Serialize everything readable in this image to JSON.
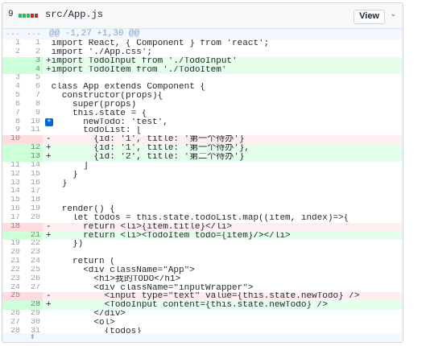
{
  "file": {
    "change_count": "9",
    "diffstat_colors": [
      "#2cbe4e",
      "#2cbe4e",
      "#2cbe4e",
      "#cb2431",
      "#cb2431"
    ],
    "name": "src/App.js",
    "view_label": "View",
    "caret": "⌄"
  },
  "hunk": {
    "ellipsis_old": "...",
    "ellipsis_new": "...",
    "header": "@@ -1,27 +1,30 @@"
  },
  "lines": [
    {
      "type": "ctx",
      "old": "1",
      "new": "1",
      "code": " import React, { Component } from 'react';"
    },
    {
      "type": "ctx",
      "old": "2",
      "new": "2",
      "code": " import './App.css';"
    },
    {
      "type": "add",
      "old": "",
      "new": "3",
      "code": "+import TodoInput from './TodoInput'"
    },
    {
      "type": "add",
      "old": "",
      "new": "4",
      "code": "+import TodoItem from './TodoItem'"
    },
    {
      "type": "ctx",
      "old": "3",
      "new": "5",
      "code": ""
    },
    {
      "type": "ctx",
      "old": "4",
      "new": "6",
      "code": " class App extends Component {"
    },
    {
      "type": "ctx",
      "old": "5",
      "new": "7",
      "code": "   constructor(props){"
    },
    {
      "type": "ctx",
      "old": "6",
      "new": "8",
      "code": "     super(props)"
    },
    {
      "type": "ctx",
      "old": "7",
      "new": "9",
      "code": "     this.state = {"
    },
    {
      "type": "ctx",
      "old": "8",
      "new": "10",
      "code": "       newTodo: 'test',",
      "plus": true
    },
    {
      "type": "ctx",
      "old": "9",
      "new": "11",
      "code": "       todoList: ["
    },
    {
      "type": "del",
      "old": "10",
      "new": "",
      "code": "-        {id: '1', title: '第一个待办'}"
    },
    {
      "type": "add",
      "old": "",
      "new": "12",
      "code": "+        {id: '1', title: '第一个待办'},"
    },
    {
      "type": "add",
      "old": "",
      "new": "13",
      "code": "+        {id: '2', title: '第二个待办'}"
    },
    {
      "type": "ctx",
      "old": "11",
      "new": "14",
      "code": "       ]"
    },
    {
      "type": "ctx",
      "old": "12",
      "new": "15",
      "code": "     }"
    },
    {
      "type": "ctx",
      "old": "13",
      "new": "16",
      "code": "   }"
    },
    {
      "type": "ctx",
      "old": "14",
      "new": "17",
      "code": ""
    },
    {
      "type": "ctx",
      "old": "15",
      "new": "18",
      "code": ""
    },
    {
      "type": "ctx",
      "old": "16",
      "new": "19",
      "code": "   render() {"
    },
    {
      "type": "ctx",
      "old": "17",
      "new": "20",
      "code": "     let todos = this.state.todoList.map((item, index)=>{"
    },
    {
      "type": "del",
      "old": "18",
      "new": "",
      "code": "-      return <li>{item.title}</li>"
    },
    {
      "type": "add",
      "old": "",
      "new": "21",
      "code": "+      return <li><TodoItem todo={item}/></li>"
    },
    {
      "type": "ctx",
      "old": "19",
      "new": "22",
      "code": "     })"
    },
    {
      "type": "ctx",
      "old": "20",
      "new": "23",
      "code": ""
    },
    {
      "type": "ctx",
      "old": "21",
      "new": "24",
      "code": "     return ("
    },
    {
      "type": "ctx",
      "old": "22",
      "new": "25",
      "code": "       <div className=\"App\">"
    },
    {
      "type": "ctx",
      "old": "23",
      "new": "26",
      "code": "         <h1>我的TODO</h1>"
    },
    {
      "type": "ctx",
      "old": "24",
      "new": "27",
      "code": "         <div className=\"inputWrapper\">"
    },
    {
      "type": "del",
      "old": "25",
      "new": "",
      "code": "-          <input type=\"text\" value={this.state.newTodo} />"
    },
    {
      "type": "add",
      "old": "",
      "new": "28",
      "code": "+          <TodoInput content={this.state.newTodo} />"
    },
    {
      "type": "ctx",
      "old": "26",
      "new": "29",
      "code": "         </div>"
    },
    {
      "type": "ctx",
      "old": "27",
      "new": "30",
      "code": "         <ol>"
    },
    {
      "type": "ctx",
      "old": "28",
      "new": "31",
      "code": "           {todos}"
    }
  ],
  "footer": {
    "expand_icon": "expand-icon"
  }
}
